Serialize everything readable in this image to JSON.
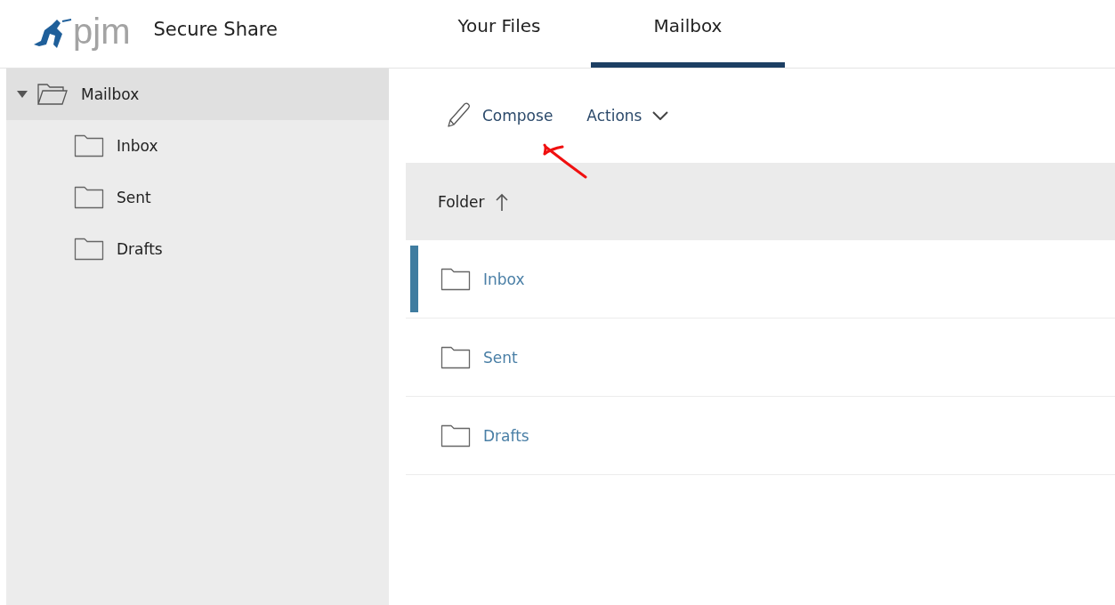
{
  "header": {
    "logo": "pjm",
    "app_title": "Secure Share"
  },
  "tabs": [
    {
      "label": "Your Files",
      "selected": false
    },
    {
      "label": "Mailbox",
      "selected": true
    }
  ],
  "sidebar": {
    "tree": [
      {
        "label": "Mailbox",
        "expanded": true,
        "selected": true,
        "children": [
          {
            "label": "Inbox",
            "selected": false
          },
          {
            "label": "Sent",
            "selected": false
          },
          {
            "label": "Drafts",
            "selected": false
          }
        ]
      }
    ]
  },
  "toolbar": {
    "buttons": [
      {
        "label": "Compose",
        "kind": "compose"
      },
      {
        "label": "Actions",
        "kind": "menu"
      }
    ]
  },
  "table": {
    "columns": [
      {
        "label": "Folder",
        "sort_ascending": true
      }
    ],
    "rows": [
      {
        "name": "Inbox",
        "selected": true
      },
      {
        "name": "Sent",
        "selected": false
      },
      {
        "name": "Drafts",
        "selected": false
      }
    ]
  }
}
